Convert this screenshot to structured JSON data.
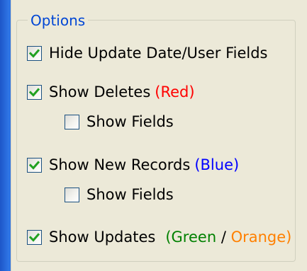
{
  "options_group": {
    "title": "Options",
    "items": [
      {
        "label": "Hide Update Date/User Fields",
        "checked": true
      },
      {
        "label": "Show Deletes",
        "suffix": "(Red)",
        "checked": true,
        "child": {
          "label": "Show Fields",
          "checked": false
        }
      },
      {
        "label": "Show New Records",
        "suffix": "(Blue)",
        "checked": true,
        "child": {
          "label": "Show Fields",
          "checked": false
        }
      },
      {
        "label": "Show Updates",
        "suffix_green": "(Green",
        "suffix_sep": " / ",
        "suffix_orange": "Orange)",
        "checked": true
      }
    ]
  },
  "colors": {
    "legend": "#0046d5",
    "red": "#ff0000",
    "blue": "#0000ff",
    "green": "#008000",
    "orange": "#ff8000",
    "check": "#21a121"
  }
}
